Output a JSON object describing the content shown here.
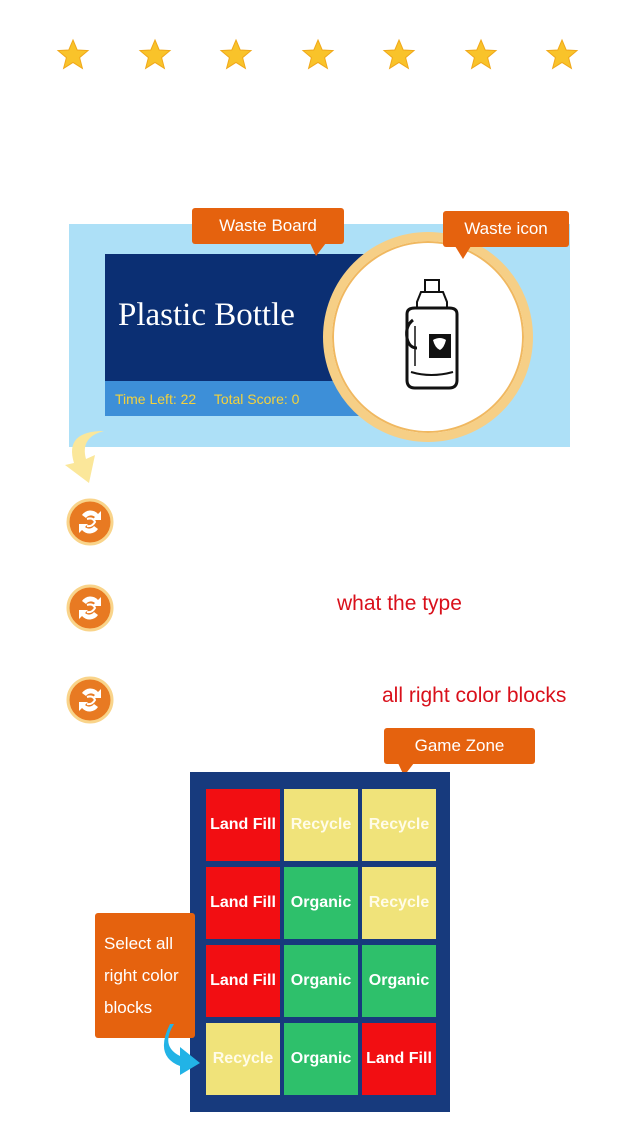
{
  "stars": {
    "count": 7,
    "color": "#f9c32a"
  },
  "board": {
    "title": "Plastic Bottle",
    "time_left": "Time Left: 22",
    "total_score": "Total Score: 0"
  },
  "callouts": {
    "waste_board": "Waste Board",
    "waste_icon": "Waste icon",
    "game_zone": "Game Zone",
    "select_lines": [
      "Select all",
      "right color",
      "blocks"
    ]
  },
  "steps": [
    {
      "icon": "recycle-icon",
      "text": ""
    },
    {
      "icon": "recycle-icon",
      "text": "what the type"
    },
    {
      "icon": "recycle-icon",
      "text": "all right color blocks"
    }
  ],
  "grid": {
    "rows": [
      [
        {
          "label": "Land Fill",
          "type": "landfill"
        },
        {
          "label": "Recycle",
          "type": "recycle"
        },
        {
          "label": "Recycle",
          "type": "recycle"
        }
      ],
      [
        {
          "label": "Land Fill",
          "type": "landfill"
        },
        {
          "label": "Organic",
          "type": "organic"
        },
        {
          "label": "Recycle",
          "type": "recycle"
        }
      ],
      [
        {
          "label": "Land Fill",
          "type": "landfill"
        },
        {
          "label": "Organic",
          "type": "organic"
        },
        {
          "label": "Organic",
          "type": "organic"
        }
      ],
      [
        {
          "label": "Recycle",
          "type": "recycle"
        },
        {
          "label": "Organic",
          "type": "organic"
        },
        {
          "label": "Land Fill",
          "type": "landfill"
        }
      ]
    ]
  },
  "colors": {
    "accent": "#e5620e",
    "board": "#0b2f73",
    "landfill": "#f20e12",
    "recycle": "#f0e37a",
    "organic": "#2ec06b",
    "instruction_text": "#d9101b"
  }
}
